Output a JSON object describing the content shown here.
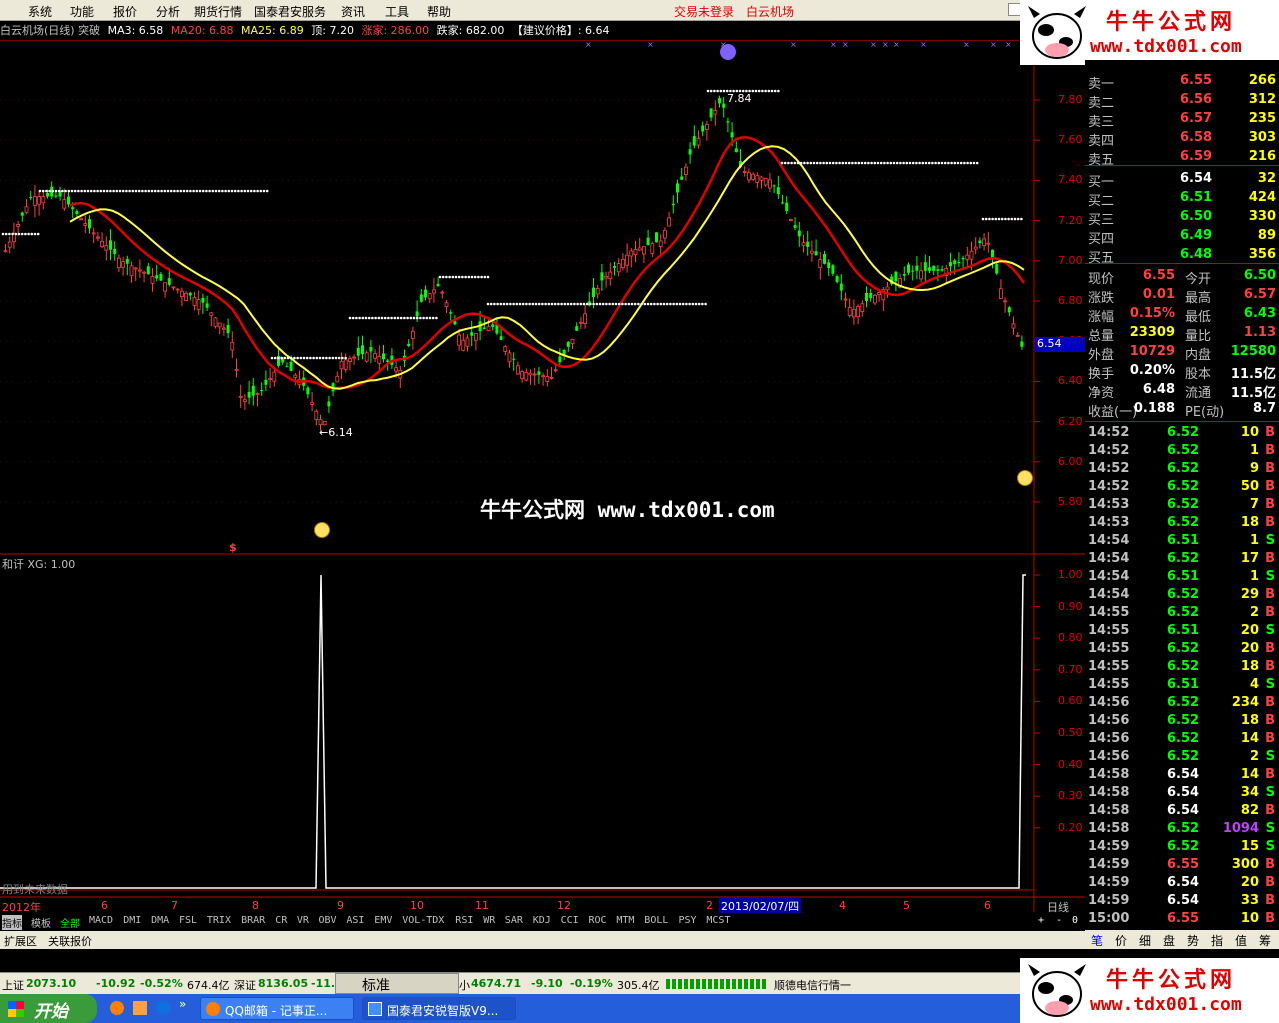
{
  "menu": {
    "items": [
      "系统",
      "功能",
      "报价",
      "分析",
      "期货行情",
      "国泰君安服务",
      "资讯",
      "工具",
      "帮助"
    ],
    "trade_status": "交易未登录",
    "stock_name": "白云机场"
  },
  "chart_header": {
    "title": "白云机场(日线) 突破",
    "ma3": "MA3: 6.58",
    "ma20": "MA20: 6.88",
    "ma25": "MA25: 6.89",
    "top": "顶: 7.20",
    "up_count": "涨家: 286.00",
    "down_count": "跌家: 682.00",
    "suggest": "【建议价格】: 6.64"
  },
  "price_axis": [
    "7.80",
    "7.60",
    "7.40",
    "7.20",
    "7.00",
    "6.80",
    "6.60",
    "6.40",
    "6.20",
    "6.00",
    "5.80"
  ],
  "current_price_tag": "6.54",
  "annotations": {
    "high": "7.84",
    "low": "←6.14",
    "signal": "$"
  },
  "indicator_header": "和讦 XG: 1.00",
  "indicator_axis": [
    "1.00",
    "0.90",
    "0.80",
    "0.70",
    "0.60",
    "0.50",
    "0.40",
    "0.30",
    "0.20"
  ],
  "future_data_note": "用到未来数据",
  "date_axis": {
    "year": "2012年",
    "months": [
      "6",
      "7",
      "8",
      "9",
      "10",
      "11",
      "12",
      "2",
      "4",
      "5",
      "6"
    ],
    "cursor_date": "2013/02/07/四",
    "period": "日线"
  },
  "banner_text": "牛牛公式网 www.tdx001.com",
  "logo": {
    "title": "牛牛公式网",
    "url": "www.tdx001.com"
  },
  "indicator_tabs": [
    "指标",
    "模板",
    "全部",
    "MACD",
    "DMI",
    "DMA",
    "FSL",
    "TRIX",
    "BRAR",
    "CR",
    "VR",
    "OBV",
    "ASI",
    "EMV",
    "VOL-TDX",
    "RSI",
    "WR",
    "SAR",
    "KDJ",
    "CCI",
    "ROC",
    "MTM",
    "BOLL",
    "PSY",
    "MCST"
  ],
  "tab_controls": [
    "+",
    "-",
    "0"
  ],
  "bottom_tabs": [
    "扩展区",
    "关联报价"
  ],
  "order_book": {
    "sell": [
      {
        "label": "卖五",
        "price": "6.59",
        "vol": "216"
      },
      {
        "label": "卖四",
        "price": "6.58",
        "vol": "303"
      },
      {
        "label": "卖三",
        "price": "6.57",
        "vol": "235"
      },
      {
        "label": "卖二",
        "price": "6.56",
        "vol": "312"
      },
      {
        "label": "卖一",
        "price": "6.55",
        "vol": "266"
      }
    ],
    "buy": [
      {
        "label": "买一",
        "price": "6.54",
        "vol": "32"
      },
      {
        "label": "买二",
        "price": "6.51",
        "vol": "424"
      },
      {
        "label": "买三",
        "price": "6.50",
        "vol": "330"
      },
      {
        "label": "买四",
        "price": "6.49",
        "vol": "89"
      },
      {
        "label": "买五",
        "price": "6.48",
        "vol": "356"
      }
    ]
  },
  "quote_stats": [
    {
      "l1": "现价",
      "v1": "6.55",
      "c1": "#ff4040",
      "l2": "今开",
      "v2": "6.50",
      "c2": "#00ff00"
    },
    {
      "l1": "涨跌",
      "v1": "0.01",
      "c1": "#ff4040",
      "l2": "最高",
      "v2": "6.57",
      "c2": "#ff4040"
    },
    {
      "l1": "涨幅",
      "v1": "0.15%",
      "c1": "#ff4040",
      "l2": "最低",
      "v2": "6.43",
      "c2": "#00ff00"
    },
    {
      "l1": "总量",
      "v1": "23309",
      "c1": "#ffff00",
      "l2": "量比",
      "v2": "1.13",
      "c2": "#ff4040"
    },
    {
      "l1": "外盘",
      "v1": "10729",
      "c1": "#ff4040",
      "l2": "内盘",
      "v2": "12580",
      "c2": "#00ff00"
    },
    {
      "l1": "换手",
      "v1": "0.20%",
      "c1": "#ffffff",
      "l2": "股本",
      "v2": "11.5亿",
      "c2": "#ffffff"
    },
    {
      "l1": "净资",
      "v1": "6.48",
      "c1": "#ffffff",
      "l2": "流通",
      "v2": "11.5亿",
      "c2": "#ffffff"
    },
    {
      "l1": "收益(一)",
      "v1": "0.188",
      "c1": "#ffffff",
      "l2": "PE(动)",
      "v2": "8.7",
      "c2": "#ffffff"
    }
  ],
  "ticks": [
    {
      "t": "14:52",
      "p": "6.52",
      "v": "10",
      "d": "B",
      "pc": "#00ff00",
      "vc": "#ffff00",
      "dc": "#ff4040"
    },
    {
      "t": "14:52",
      "p": "6.52",
      "v": "1",
      "d": "B",
      "pc": "#00ff00",
      "vc": "#ffff00",
      "dc": "#ff4040"
    },
    {
      "t": "14:52",
      "p": "6.52",
      "v": "9",
      "d": "B",
      "pc": "#00ff00",
      "vc": "#ffff00",
      "dc": "#ff4040"
    },
    {
      "t": "14:52",
      "p": "6.52",
      "v": "50",
      "d": "B",
      "pc": "#00ff00",
      "vc": "#ffff00",
      "dc": "#ff4040"
    },
    {
      "t": "14:53",
      "p": "6.52",
      "v": "7",
      "d": "B",
      "pc": "#00ff00",
      "vc": "#ffff00",
      "dc": "#ff4040"
    },
    {
      "t": "14:53",
      "p": "6.52",
      "v": "18",
      "d": "B",
      "pc": "#00ff00",
      "vc": "#ffff00",
      "dc": "#ff4040"
    },
    {
      "t": "14:54",
      "p": "6.51",
      "v": "1",
      "d": "S",
      "pc": "#00ff00",
      "vc": "#ffff00",
      "dc": "#00ff00"
    },
    {
      "t": "14:54",
      "p": "6.52",
      "v": "17",
      "d": "B",
      "pc": "#00ff00",
      "vc": "#ffff00",
      "dc": "#ff4040"
    },
    {
      "t": "14:54",
      "p": "6.51",
      "v": "1",
      "d": "S",
      "pc": "#00ff00",
      "vc": "#ffff00",
      "dc": "#00ff00"
    },
    {
      "t": "14:54",
      "p": "6.52",
      "v": "29",
      "d": "B",
      "pc": "#00ff00",
      "vc": "#ffff00",
      "dc": "#ff4040"
    },
    {
      "t": "14:55",
      "p": "6.52",
      "v": "2",
      "d": "B",
      "pc": "#00ff00",
      "vc": "#ffff00",
      "dc": "#ff4040"
    },
    {
      "t": "14:55",
      "p": "6.51",
      "v": "20",
      "d": "S",
      "pc": "#00ff00",
      "vc": "#ffff00",
      "dc": "#00ff00"
    },
    {
      "t": "14:55",
      "p": "6.52",
      "v": "20",
      "d": "B",
      "pc": "#00ff00",
      "vc": "#ffff00",
      "dc": "#ff4040"
    },
    {
      "t": "14:55",
      "p": "6.52",
      "v": "18",
      "d": "B",
      "pc": "#00ff00",
      "vc": "#ffff00",
      "dc": "#ff4040"
    },
    {
      "t": "14:55",
      "p": "6.51",
      "v": "4",
      "d": "S",
      "pc": "#00ff00",
      "vc": "#ffff00",
      "dc": "#00ff00"
    },
    {
      "t": "14:56",
      "p": "6.52",
      "v": "234",
      "d": "B",
      "pc": "#00ff00",
      "vc": "#ffff00",
      "dc": "#ff4040"
    },
    {
      "t": "14:56",
      "p": "6.52",
      "v": "18",
      "d": "B",
      "pc": "#00ff00",
      "vc": "#ffff00",
      "dc": "#ff4040"
    },
    {
      "t": "14:56",
      "p": "6.52",
      "v": "14",
      "d": "B",
      "pc": "#00ff00",
      "vc": "#ffff00",
      "dc": "#ff4040"
    },
    {
      "t": "14:56",
      "p": "6.52",
      "v": "2",
      "d": "S",
      "pc": "#00ff00",
      "vc": "#ffff00",
      "dc": "#00ff00"
    },
    {
      "t": "14:58",
      "p": "6.54",
      "v": "14",
      "d": "B",
      "pc": "#ffffff",
      "vc": "#ffff00",
      "dc": "#ff4040"
    },
    {
      "t": "14:58",
      "p": "6.54",
      "v": "34",
      "d": "S",
      "pc": "#ffffff",
      "vc": "#ffff00",
      "dc": "#00ff00"
    },
    {
      "t": "14:58",
      "p": "6.54",
      "v": "82",
      "d": "B",
      "pc": "#ffffff",
      "vc": "#ffff00",
      "dc": "#ff4040"
    },
    {
      "t": "14:58",
      "p": "6.52",
      "v": "1094",
      "d": "S",
      "pc": "#00ff00",
      "vc": "#c040ff",
      "dc": "#00ff00"
    },
    {
      "t": "14:59",
      "p": "6.52",
      "v": "15",
      "d": "S",
      "pc": "#00ff00",
      "vc": "#ffff00",
      "dc": "#00ff00"
    },
    {
      "t": "14:59",
      "p": "6.55",
      "v": "300",
      "d": "B",
      "pc": "#ff4040",
      "vc": "#ffff00",
      "dc": "#ff4040"
    },
    {
      "t": "14:59",
      "p": "6.54",
      "v": "20",
      "d": "B",
      "pc": "#ffffff",
      "vc": "#ffff00",
      "dc": "#ff4040"
    },
    {
      "t": "14:59",
      "p": "6.54",
      "v": "33",
      "d": "B",
      "pc": "#ffffff",
      "vc": "#ffff00",
      "dc": "#ff4040"
    },
    {
      "t": "15:00",
      "p": "6.55",
      "v": "10",
      "d": "B",
      "pc": "#ff4040",
      "vc": "#ffff00",
      "dc": "#ff4040"
    }
  ],
  "panel_tabs": [
    "笔",
    "价",
    "细",
    "盘",
    "势",
    "指",
    "值",
    "筹"
  ],
  "status": {
    "sh_label": "上证",
    "sh_index": "2073.10",
    "sh_change": "-10.92",
    "sh_pct": "-0.52%",
    "sh_amount": "674.4亿",
    "sz_label": "深证",
    "sz_index": "8136.05",
    "sz_change": "-11.",
    "mode": "标准",
    "small_label": "小",
    "small_index": "4674.71",
    "small_change": "-9.10",
    "small_pct": "-0.19%",
    "small_amount": "305.4亿",
    "server": "顺德电信行情一"
  },
  "taskbar": {
    "start": "开始",
    "tasks": [
      "QQ邮箱 - 记事正...",
      "国泰君安锐智版V9..."
    ]
  },
  "colors": {
    "up": "#ff4040",
    "down": "#00ff00",
    "ma_red": "#e00000",
    "ma_yellow": "#ffff40",
    "panel_bg": "#000000"
  }
}
